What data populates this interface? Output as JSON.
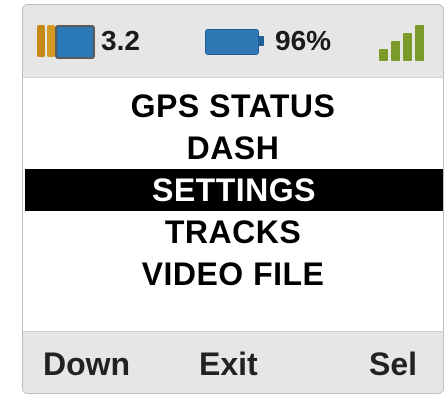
{
  "status_bar": {
    "storage": {
      "icon": "storage-card-icon",
      "value": "3.2"
    },
    "battery": {
      "icon": "battery-icon",
      "value": "96%"
    },
    "signal": {
      "icon": "signal-strength-icon",
      "bars": 4
    }
  },
  "menu": {
    "items": [
      {
        "label": "GPS STATUS"
      },
      {
        "label": "DASH"
      },
      {
        "label": "SETTINGS",
        "selected": true
      },
      {
        "label": "TRACKS"
      },
      {
        "label": "VIDEO FILE"
      }
    ]
  },
  "softkeys": {
    "left": "Down",
    "center": "Exit",
    "right": "Sel"
  },
  "colors": {
    "selection_bg": "#000000",
    "selection_text": "#ffffff",
    "bar_bg": "#e6e6e6",
    "battery": "#2f77b5",
    "signal": "#7a9a2a"
  }
}
